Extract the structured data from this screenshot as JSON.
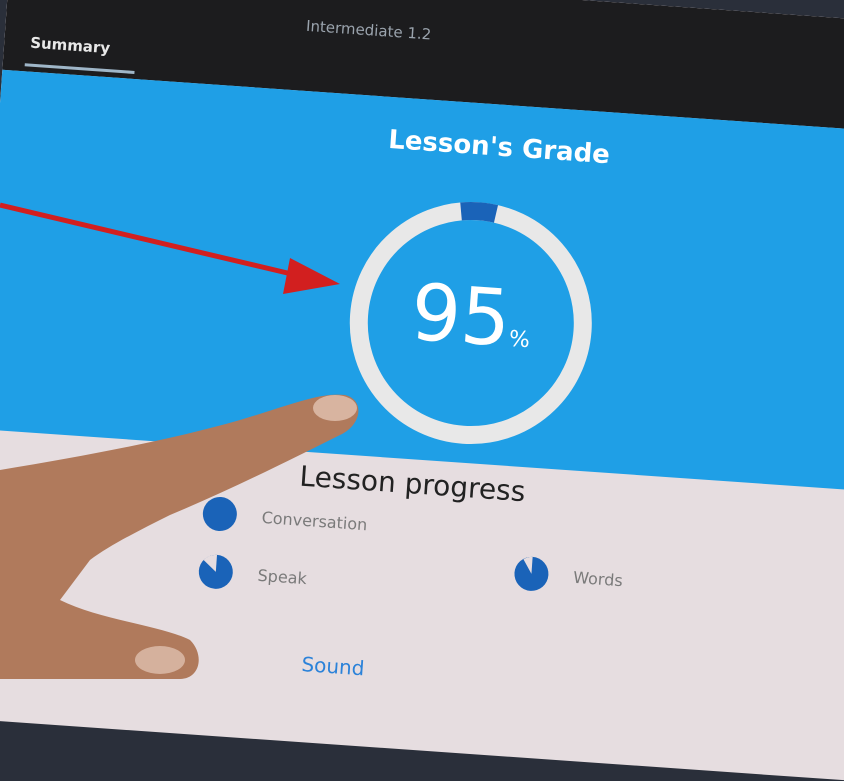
{
  "header": {
    "course_title": "Intermediate 1.2",
    "tab_summary": "Summary"
  },
  "grade": {
    "title": "Lesson's Grade",
    "value": "95",
    "unit": "%",
    "fraction": 0.95,
    "ring_color": "#e8e8e8",
    "accent_color": "#1a63b8"
  },
  "progress": {
    "title": "Lesson progress",
    "items": [
      {
        "label": "Conversation"
      },
      {
        "label": "Speak"
      },
      {
        "label": "Words"
      }
    ]
  },
  "footer": {
    "link": "Sound"
  },
  "colors": {
    "panel_blue": "#1f9fe6",
    "arrow_red": "#d21f1f",
    "bg_pink": "#e6dde0"
  }
}
